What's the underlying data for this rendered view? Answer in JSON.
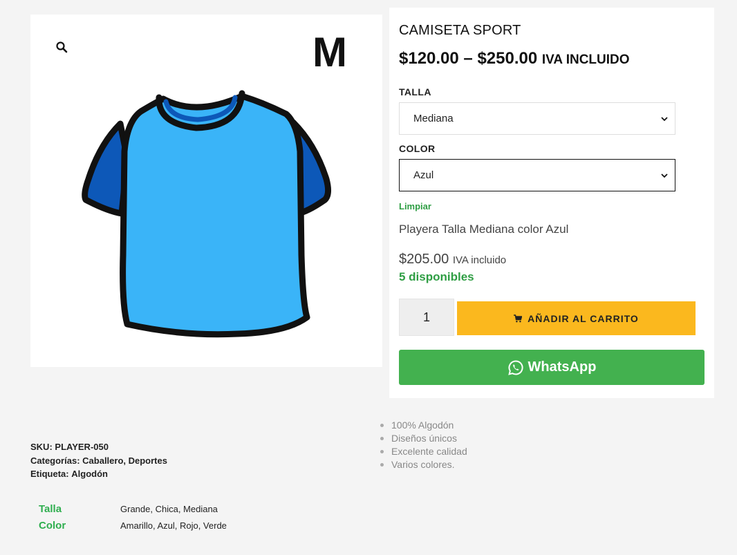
{
  "gallery": {
    "size_badge": "M",
    "zoom_icon": "search-icon",
    "image_icon": "tshirt-icon"
  },
  "product": {
    "title": "CAMISETA SPORT",
    "price_range": "$120.00 – $250.00",
    "price_suffix": "IVA INCLUIDO"
  },
  "variations": {
    "talla_label": "TALLA",
    "talla_value": "Mediana",
    "color_label": "COLOR",
    "color_value": "Azul",
    "clear_label": "Limpiar"
  },
  "variation_info": {
    "description": "Playera Talla Mediana color Azul",
    "price": "$205.00",
    "price_suffix": "IVA incluido",
    "stock": "5 disponibles"
  },
  "cart": {
    "quantity": "1",
    "add_label": "AÑADIR AL CARRITO",
    "cart_icon": "cart-icon"
  },
  "whatsapp": {
    "label": "WhatsApp",
    "icon": "whatsapp-icon"
  },
  "features": [
    "100% Algodón",
    "Diseños únicos",
    "Excelente calidad",
    "Varios colores."
  ],
  "meta": {
    "sku_label": "SKU:",
    "sku_value": "PLAYER-050",
    "categories_label": "Categorías:",
    "categories_value": "Caballero, Deportes",
    "tag_label": "Etiqueta:",
    "tag_value": "Algodón"
  },
  "attributes": [
    {
      "name": "Talla",
      "value": "Grande, Chica, Mediana"
    },
    {
      "name": "Color",
      "value": "Amarillo, Azul, Rojo, Verde"
    }
  ],
  "colors": {
    "accent_green": "#2f9e44",
    "button_yellow": "#fbb81e",
    "whatsapp_green": "#43b14f",
    "shirt_body": "#3ab4f8",
    "shirt_sleeve": "#0d58b8"
  }
}
